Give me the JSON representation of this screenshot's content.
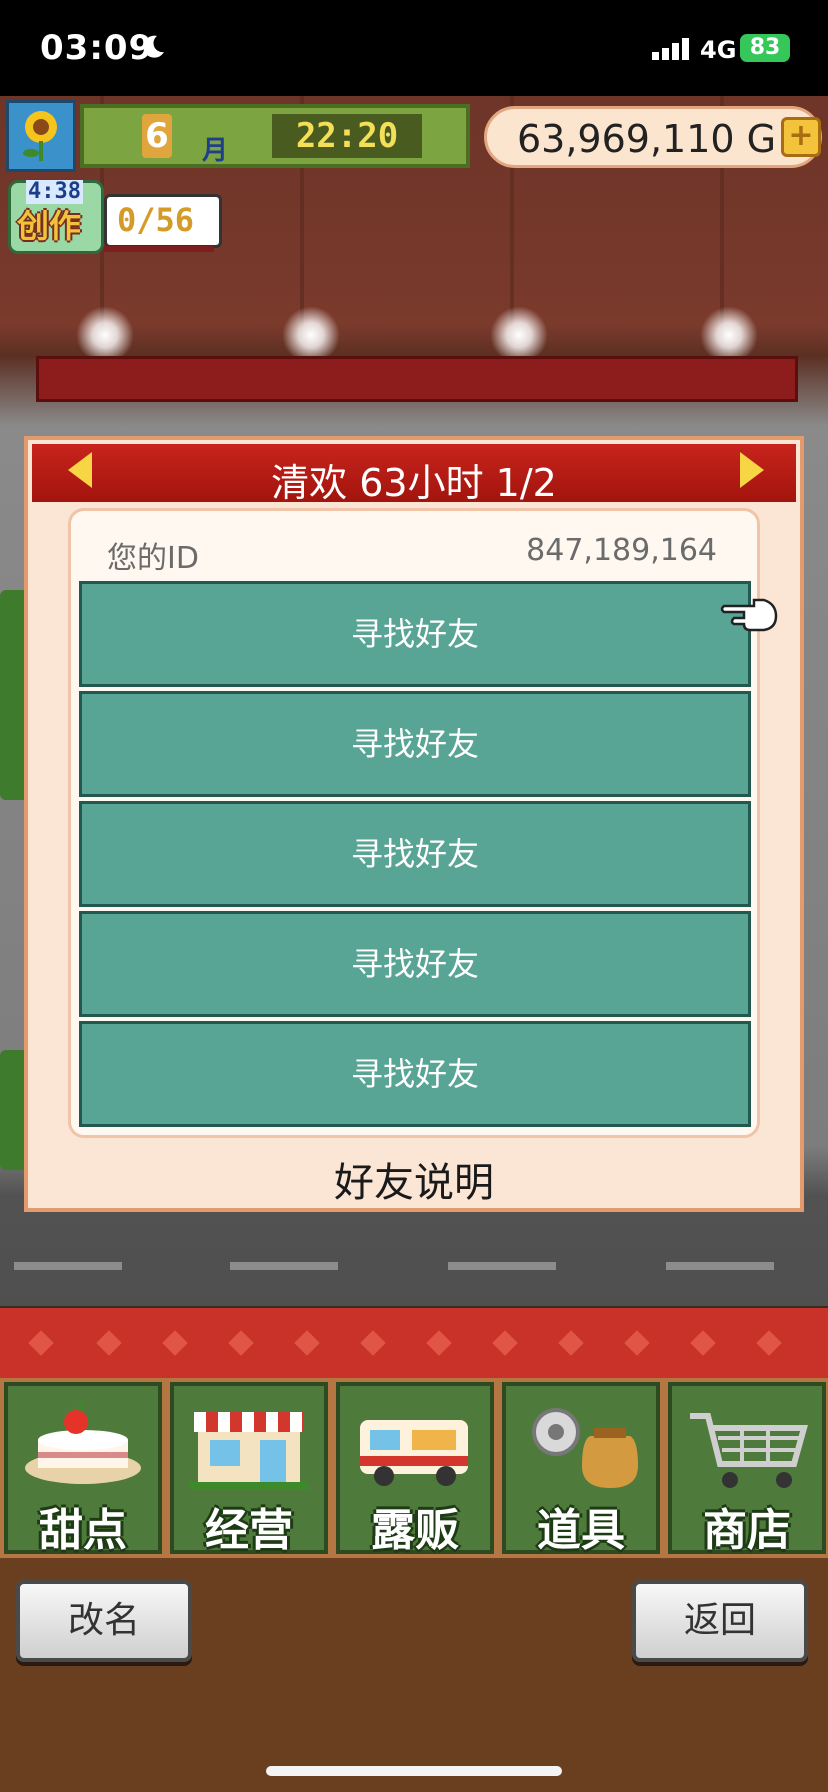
{
  "status_bar": {
    "time": "03:09",
    "network": "4G",
    "battery": "83",
    "icons": [
      "moon-icon",
      "signal-icon",
      "battery-icon"
    ]
  },
  "hud": {
    "month": "6",
    "month_unit": "月",
    "clock": "22:20",
    "money": "63,969,110 G",
    "add_money_symbol": "+",
    "create_label": "创作",
    "create_timer": "4:38",
    "create_progress": "0/56"
  },
  "dialog": {
    "title": "清欢  63小时 1/2",
    "id_label": "您的ID",
    "id_value": "847,189,164",
    "friend_slots": [
      "寻找好友",
      "寻找好友",
      "寻找好友",
      "寻找好友",
      "寻找好友"
    ],
    "help_link": "好友说明"
  },
  "menu": {
    "items": [
      {
        "label": "甜点",
        "icon": "cake-icon"
      },
      {
        "label": "经营",
        "icon": "shop-icon"
      },
      {
        "label": "露贩",
        "icon": "food-truck-icon"
      },
      {
        "label": "道具",
        "icon": "items-bag-icon"
      },
      {
        "label": "商店",
        "icon": "shopping-cart-icon"
      }
    ]
  },
  "footer": {
    "rename_label": "改名",
    "back_label": "返回"
  },
  "colors": {
    "header_red": "#b71c14",
    "slot_teal": "#58a595",
    "menu_green": "#4e7a3b",
    "dialog_bg": "#fbe6d6"
  }
}
